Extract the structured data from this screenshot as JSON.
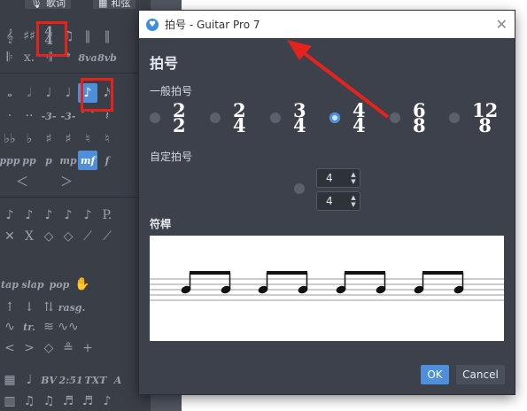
{
  "palette": {
    "top_buttons": [
      "歌词",
      "和弦"
    ],
    "dynamics": [
      "ppp",
      "pp",
      "p",
      "mp",
      "mf",
      "f"
    ],
    "row_labels": [
      "BV",
      "2:51",
      "TXT",
      "A"
    ],
    "effect_labels": [
      "tap",
      "slap",
      "pop",
      "rasg.",
      "tr."
    ]
  },
  "dialog": {
    "title": "拍号 - Guitar Pro 7",
    "heading": "拍号",
    "common_label": "一般拍号",
    "time_signatures": [
      {
        "top": "2",
        "bottom": "2",
        "selected": false
      },
      {
        "top": "2",
        "bottom": "4",
        "selected": false
      },
      {
        "top": "3",
        "bottom": "4",
        "selected": false
      },
      {
        "top": "4",
        "bottom": "4",
        "selected": true
      },
      {
        "top": "6",
        "bottom": "8",
        "selected": false
      },
      {
        "top": "12",
        "bottom": "8",
        "selected": false
      }
    ],
    "custom_label": "自定拍号",
    "custom_numerator": "4",
    "custom_denominator": "4",
    "beam_label": "符桿",
    "ok": "OK",
    "cancel": "Cancel"
  },
  "colors": {
    "accent": "#4e8fdb",
    "highlight": "#e5221d",
    "dialog_bg": "#3c414b"
  }
}
